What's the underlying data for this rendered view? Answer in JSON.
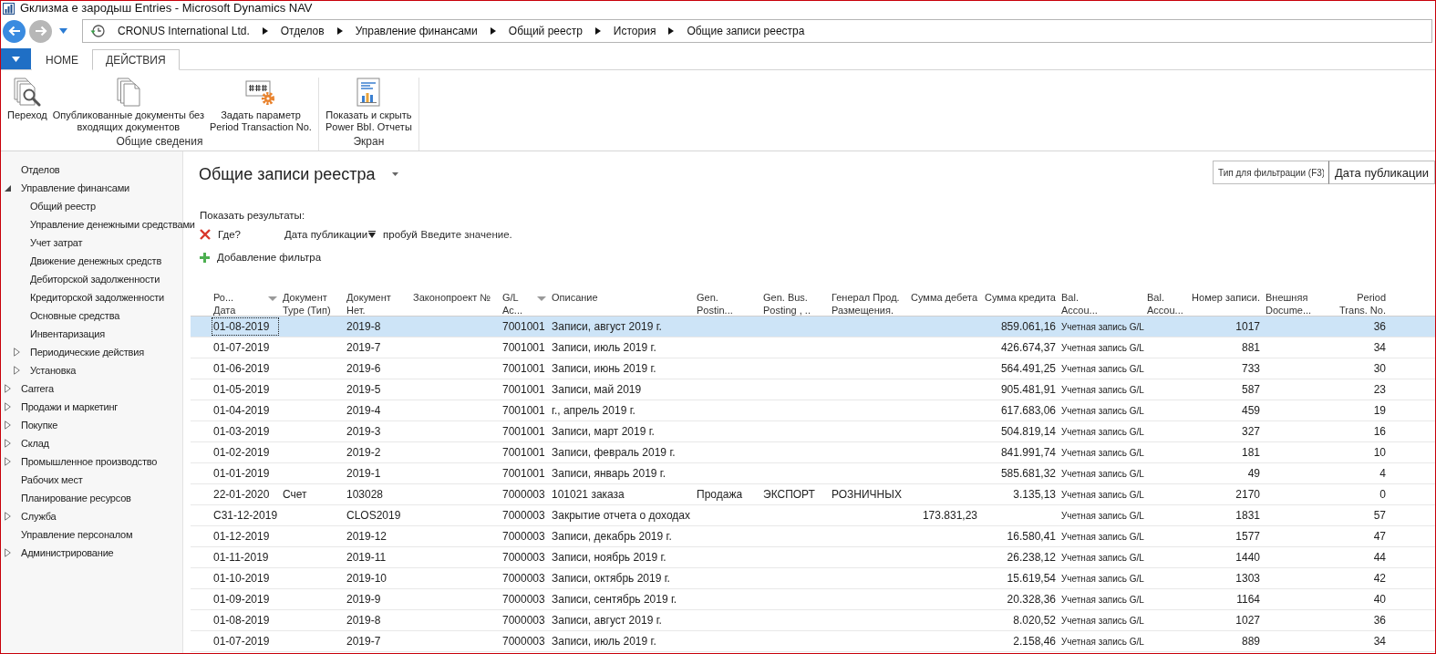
{
  "window": {
    "title": "Gклизма е зародыш Entries - Microsoft Dynamics NAV"
  },
  "address_bar": {
    "breadcrumbs": [
      "CRONUS International Ltd.",
      "Отделов",
      "Управление финансами",
      "Общий реестр",
      "История",
      "Общие записи реестра"
    ]
  },
  "ribbon": {
    "tabs": [
      {
        "label": "HOME",
        "selected": false
      },
      {
        "label": "ДЕЙСТВИЯ",
        "selected": true
      }
    ],
    "groups": [
      {
        "label": "Общие сведения",
        "buttons": [
          {
            "kind": "find",
            "label": "Переход"
          },
          {
            "kind": "documents",
            "label": "Опубликованные документы без\nвходящих документов"
          },
          {
            "kind": "number_series",
            "label": "Задать параметр\nPeriod Transaction No."
          }
        ]
      },
      {
        "label": "Экран",
        "buttons": [
          {
            "kind": "report",
            "label": "Показать и скрыть\nPower BbI. Отчеты"
          }
        ]
      }
    ]
  },
  "sidebar": {
    "items": [
      {
        "label": "Отделов",
        "kind": "page"
      },
      {
        "label": "Управление финансами",
        "kind": "group",
        "expanded": true,
        "children": [
          {
            "label": "Общий реестр",
            "kind": "page"
          },
          {
            "label": "Управление денежными средствами",
            "kind": "page"
          },
          {
            "label": "Учет затрат",
            "kind": "page"
          },
          {
            "label": "Движение денежных средств",
            "kind": "page"
          },
          {
            "label": "Дебиторской задолженности",
            "kind": "page"
          },
          {
            "label": "Кредиторской задолженности",
            "kind": "page"
          },
          {
            "label": "Основные средства",
            "kind": "page"
          },
          {
            "label": "Инвентаризация",
            "kind": "page"
          },
          {
            "label": "Периодические действия",
            "kind": "group",
            "expanded": false
          },
          {
            "label": "Установка",
            "kind": "group",
            "expanded": false
          }
        ]
      },
      {
        "label": "Carrera",
        "kind": "group",
        "expanded": false
      },
      {
        "label": "Продажи и маркетинг",
        "kind": "group",
        "expanded": false
      },
      {
        "label": "Покупке",
        "kind": "group",
        "expanded": false
      },
      {
        "label": "Склад",
        "kind": "group",
        "expanded": false
      },
      {
        "label": "Промышленное производство",
        "kind": "group",
        "expanded": false
      },
      {
        "label": "Рабочих мест",
        "kind": "page"
      },
      {
        "label": "Планирование ресурсов",
        "kind": "page"
      },
      {
        "label": "Служба",
        "kind": "group",
        "expanded": false
      },
      {
        "label": "Управление персоналом",
        "kind": "page"
      },
      {
        "label": "Администрирование",
        "kind": "group",
        "expanded": false
      }
    ]
  },
  "page": {
    "title": "Общие записи реестра",
    "search": {
      "placeholder": "Тип для фильтрации (F3)",
      "field": "Дата публикации"
    },
    "filter": {
      "heading": "Показать результаты:",
      "where": "Где?",
      "field": "Дата публикации",
      "operator": "пробуй",
      "placeholder": "Введите значение.",
      "add": "Добавление фильтра"
    }
  },
  "table": {
    "columns": [
      {
        "label": "Ро...\nДата",
        "kind": "text",
        "sort_caret": true
      },
      {
        "label": "Документ\nType (Тип)",
        "kind": "text",
        "sort_caret": false
      },
      {
        "label": "Документ\nНет.",
        "kind": "text",
        "sort_caret": false
      },
      {
        "label": "Законопроект №",
        "kind": "text",
        "sort_caret": false
      },
      {
        "label": "G/L\nAc...",
        "kind": "text",
        "sort_caret": true
      },
      {
        "label": "Описание",
        "kind": "text",
        "sort_caret": false
      },
      {
        "label": "Gen.\nPostin...",
        "kind": "text",
        "sort_caret": false
      },
      {
        "label": "Gen. Bus.\nPosting , ..",
        "kind": "text",
        "sort_caret": false
      },
      {
        "label": "Генерал Прод.\nРазмещения.",
        "kind": "text",
        "sort_caret": false
      },
      {
        "label": "Сумма дебета",
        "kind": "number",
        "sort_caret": false
      },
      {
        "label": "Сумма кредита",
        "kind": "number",
        "sort_caret": false
      },
      {
        "label": "Bal.\nAccou...",
        "kind": "small",
        "sort_caret": false
      },
      {
        "label": "Bal.\nAccou...",
        "kind": "text",
        "sort_caret": false
      },
      {
        "label": "Номер записи.",
        "kind": "number",
        "sort_caret": false
      },
      {
        "label": "Внешняя\nDocume...",
        "kind": "text",
        "sort_caret": false
      },
      {
        "label": "Period\nTrans. No.",
        "kind": "number",
        "sort_caret": false
      }
    ],
    "rows": [
      {
        "selected": true,
        "cells": [
          "01-08-2019",
          null,
          "2019-8",
          null,
          "7001001",
          "Записи, август 2019 г.",
          null,
          null,
          null,
          null,
          "859.061,16",
          "Учетная запись G/L",
          null,
          "1017",
          null,
          "36"
        ]
      },
      {
        "selected": false,
        "cells": [
          "01-07-2019",
          null,
          "2019-7",
          null,
          "7001001",
          "Записи, июль 2019 г.",
          null,
          null,
          null,
          null,
          "426.674,37",
          "Учетная запись G/L",
          null,
          "881",
          null,
          "34"
        ]
      },
      {
        "selected": false,
        "cells": [
          "01-06-2019",
          null,
          "2019-6",
          null,
          "7001001",
          "Записи, июнь 2019 г.",
          null,
          null,
          null,
          null,
          "564.491,25",
          "Учетная запись G/L",
          null,
          "733",
          null,
          "30"
        ]
      },
      {
        "selected": false,
        "cells": [
          "01-05-2019",
          null,
          "2019-5",
          null,
          "7001001",
          "Записи, май 2019",
          null,
          null,
          null,
          null,
          "905.481,91",
          "Учетная запись G/L",
          null,
          "587",
          null,
          "23"
        ]
      },
      {
        "selected": false,
        "cells": [
          "01-04-2019",
          null,
          "2019-4",
          null,
          "7001001",
          "г., апрель 2019 г.",
          null,
          null,
          null,
          null,
          "617.683,06",
          "Учетная запись G/L",
          null,
          "459",
          null,
          "19"
        ]
      },
      {
        "selected": false,
        "cells": [
          "01-03-2019",
          null,
          "2019-3",
          null,
          "7001001",
          "Записи, март 2019 г.",
          null,
          null,
          null,
          null,
          "504.819,14",
          "Учетная запись G/L",
          null,
          "327",
          null,
          "16"
        ]
      },
      {
        "selected": false,
        "cells": [
          "01-02-2019",
          null,
          "2019-2",
          null,
          "7001001",
          "Записи, февраль 2019 г.",
          null,
          null,
          null,
          null,
          "841.991,74",
          "Учетная запись G/L",
          null,
          "181",
          null,
          "10"
        ]
      },
      {
        "selected": false,
        "cells": [
          "01-01-2019",
          null,
          "2019-1",
          null,
          "7001001",
          "Записи, январь 2019 г.",
          null,
          null,
          null,
          null,
          "585.681,32",
          "Учетная запись G/L",
          null,
          "49",
          null,
          "4"
        ]
      },
      {
        "selected": false,
        "cells": [
          "22-01-2020",
          "Счет",
          "103028",
          null,
          "7000003",
          "101021 заказа",
          "Продажа",
          "ЭКСПОРТ",
          "РОЗНИЧНЫХ",
          null,
          "3.135,13",
          "Учетная запись G/L",
          null,
          "2170",
          null,
          "0"
        ]
      },
      {
        "selected": false,
        "cells": [
          "C31-12-2019",
          null,
          "CLOS2019",
          null,
          "7000003",
          "Закрытие отчета о доходах",
          null,
          null,
          null,
          "173.831,23",
          null,
          "Учетная запись G/L",
          null,
          "1831",
          null,
          "57"
        ]
      },
      {
        "selected": false,
        "cells": [
          "01-12-2019",
          null,
          "2019-12",
          null,
          "7000003",
          "Записи, декабрь 2019 г.",
          null,
          null,
          null,
          null,
          "16.580,41",
          "Учетная запись G/L",
          null,
          "1577",
          null,
          "47"
        ]
      },
      {
        "selected": false,
        "cells": [
          "01-11-2019",
          null,
          "2019-11",
          null,
          "7000003",
          "Записи, ноябрь 2019 г.",
          null,
          null,
          null,
          null,
          "26.238,12",
          "Учетная запись G/L",
          null,
          "1440",
          null,
          "44"
        ]
      },
      {
        "selected": false,
        "cells": [
          "01-10-2019",
          null,
          "2019-10",
          null,
          "7000003",
          "Записи, октябрь 2019 г.",
          null,
          null,
          null,
          null,
          "15.619,54",
          "Учетная запись G/L",
          null,
          "1303",
          null,
          "42"
        ]
      },
      {
        "selected": false,
        "cells": [
          "01-09-2019",
          null,
          "2019-9",
          null,
          "7000003",
          "Записи, сентябрь 2019 г.",
          null,
          null,
          null,
          null,
          "20.328,36",
          "Учетная запись G/L",
          null,
          "1164",
          null,
          "40"
        ]
      },
      {
        "selected": false,
        "cells": [
          "01-08-2019",
          null,
          "2019-8",
          null,
          "7000003",
          "Записи, август 2019 г.",
          null,
          null,
          null,
          null,
          "8.020,52",
          "Учетная запись G/L",
          null,
          "1027",
          null,
          "36"
        ]
      },
      {
        "selected": false,
        "cells": [
          "01-07-2019",
          null,
          "2019-7",
          null,
          "7000003",
          "Записи, июль 2019 г.",
          null,
          null,
          null,
          null,
          "2.158,46",
          "Учетная запись G/L",
          null,
          "889",
          null,
          "34"
        ]
      }
    ]
  }
}
